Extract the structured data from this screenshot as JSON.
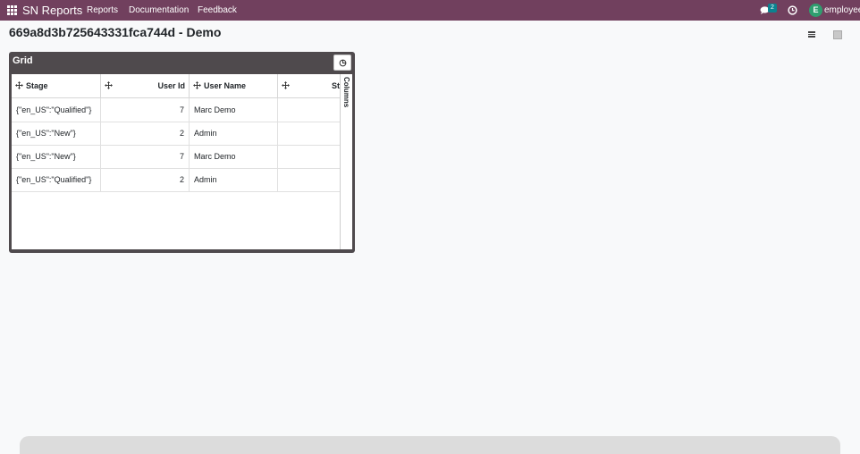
{
  "navbar": {
    "brand": "SN Reports",
    "menu": [
      "Reports",
      "Documentation",
      "Feedback"
    ],
    "chat_count": "2",
    "avatar_initial": "E",
    "user": "employee",
    "bg_color": "#71405e",
    "avatar_color": "#2f9e6f",
    "badge_color": "#0b8390"
  },
  "page": {
    "title": "669a8d3b725643331fca744d - Demo"
  },
  "grid": {
    "title": "Grid",
    "side_tab": "Columns",
    "columns": [
      "Stage",
      "User Id",
      "User Name",
      "St"
    ],
    "rows": [
      {
        "stage": "{\"en_US\":\"Qualified\"}",
        "user_id": "7",
        "user_name": "Marc Demo"
      },
      {
        "stage": "{\"en_US\":\"New\"}",
        "user_id": "2",
        "user_name": "Admin"
      },
      {
        "stage": "{\"en_US\":\"New\"}",
        "user_id": "7",
        "user_name": "Marc Demo"
      },
      {
        "stage": "{\"en_US\":\"Qualified\"}",
        "user_id": "2",
        "user_name": "Admin"
      }
    ]
  },
  "icons": [
    "apps-icon",
    "chat-icon",
    "clock-icon",
    "list-view-icon",
    "pivot-view-icon",
    "grid-menu-icon",
    "move-icon"
  ]
}
